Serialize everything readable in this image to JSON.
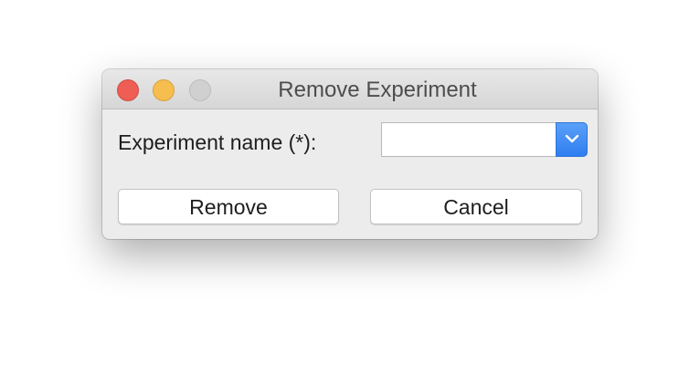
{
  "window": {
    "title": "Remove Experiment",
    "traffic_lights": {
      "close_color": "#ee5e55",
      "minimize_color": "#f6be4f",
      "zoom_color": "#d0d0d0"
    }
  },
  "form": {
    "experiment_label": "Experiment name (*):",
    "experiment_value": "",
    "arrow_icon": "chevron-down-icon",
    "accent_color": "#2f7ef0"
  },
  "buttons": {
    "remove_label": "Remove",
    "cancel_label": "Cancel"
  }
}
